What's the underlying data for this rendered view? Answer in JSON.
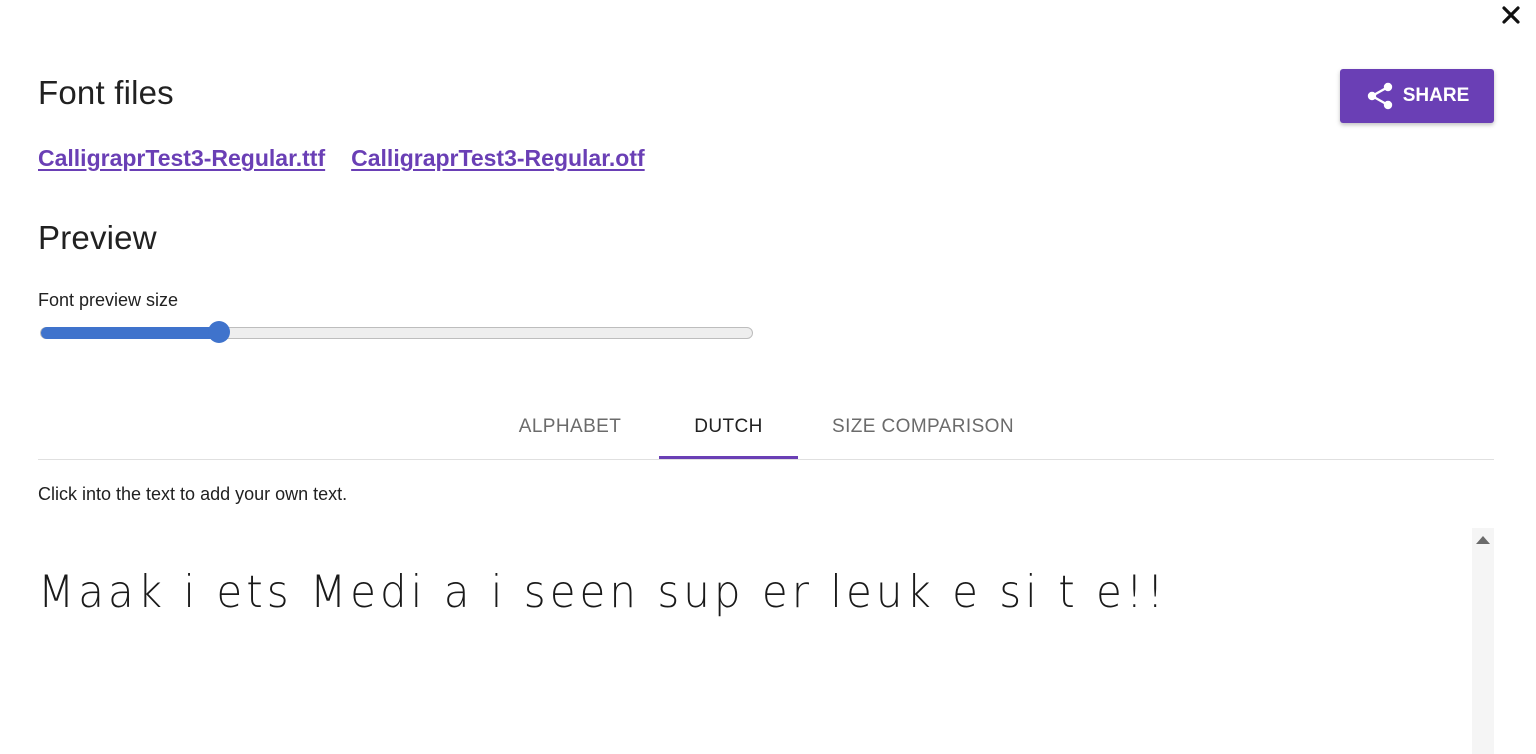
{
  "dialog": {
    "close_icon": "close-icon"
  },
  "font_files": {
    "title": "Font files",
    "links": [
      {
        "label": "CalligraprTest3-Regular.ttf"
      },
      {
        "label": "CalligraprTest3-Regular.otf"
      }
    ]
  },
  "share": {
    "label": "SHARE",
    "icon": "share-icon",
    "color": "#6a3fb5"
  },
  "preview": {
    "title": "Preview",
    "slider_label": "Font preview size",
    "slider_value": 0.25,
    "slider_color": "#3f73cc"
  },
  "tabs": [
    {
      "label": "ALPHABET",
      "active": false
    },
    {
      "label": "DUTCH",
      "active": true
    },
    {
      "label": "SIZE COMPARISON",
      "active": false
    }
  ],
  "hint": "Click into the text to add your own text.",
  "sample_text": "Maak i ets Medi a i seen sup er leuk e si t e!!",
  "colors": {
    "accent": "#6a3fb5",
    "text": "#212121",
    "muted": "#6b6b6b"
  }
}
